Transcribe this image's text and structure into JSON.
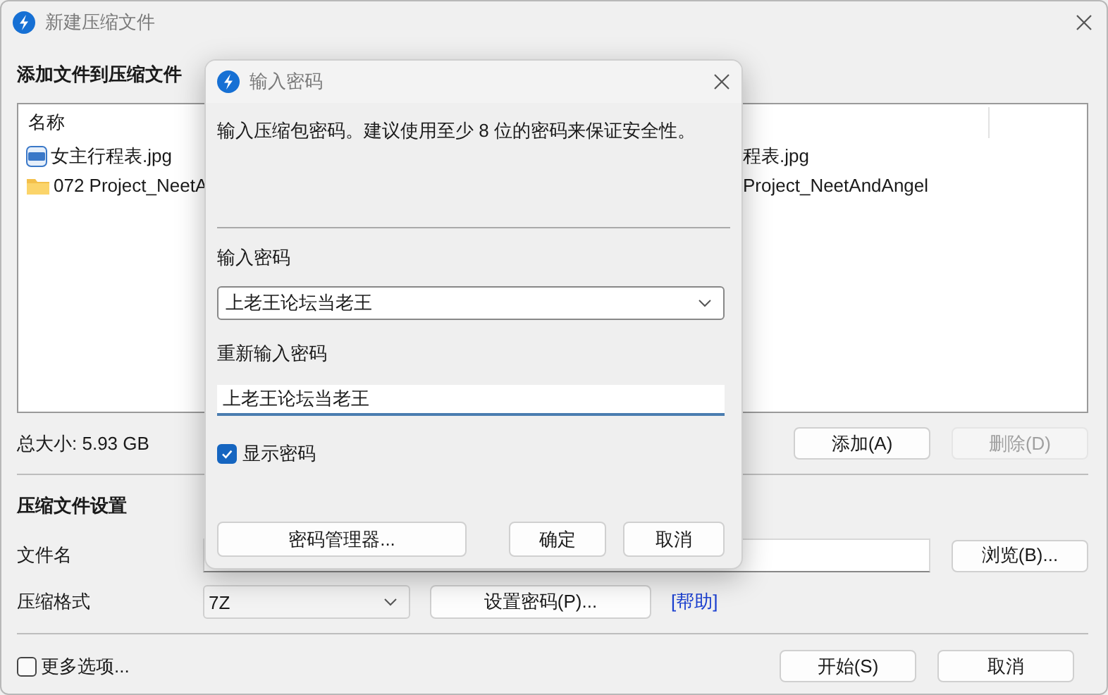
{
  "window": {
    "title": "新建压缩文件"
  },
  "files": {
    "heading": "添加文件到压缩文件",
    "columns": [
      "名称"
    ],
    "rows": [
      {
        "kind": "image",
        "name": "女主行程表.jpg",
        "column_2": "程表.jpg"
      },
      {
        "kind": "folder",
        "name": "072 Project_NeetA",
        "column_2": "Project_NeetAndAngel"
      }
    ],
    "total": "总大小: 5.93 GB",
    "buttons": [
      {
        "label": "添加(A)",
        "disabled": false
      },
      {
        "label": "删除(D)",
        "disabled": true
      }
    ]
  },
  "settings": {
    "heading": "压缩文件设置",
    "filename_label": "文件名",
    "browse_button": "浏览(B)...",
    "format_label": "压缩格式",
    "format": "7Z",
    "password_button": "设置密码(P)...",
    "help_link": "[帮助]"
  },
  "footer": {
    "more_options": {
      "label": "更多选项...",
      "checked": false
    },
    "buttons": [
      "开始(S)",
      "取消"
    ]
  },
  "dialog": {
    "title": "输入密码",
    "description": "输入压缩包密码。建议使用至少 8 位的密码来保证安全性。",
    "password_label": "输入密码",
    "password": "上老王论坛当老王",
    "confirm_label": "重新输入密码",
    "confirm": "上老王论坛当老王",
    "show_password": {
      "label": "显示密码",
      "checked": true
    },
    "buttons": [
      "密码管理器...",
      "确定",
      "取消"
    ]
  }
}
